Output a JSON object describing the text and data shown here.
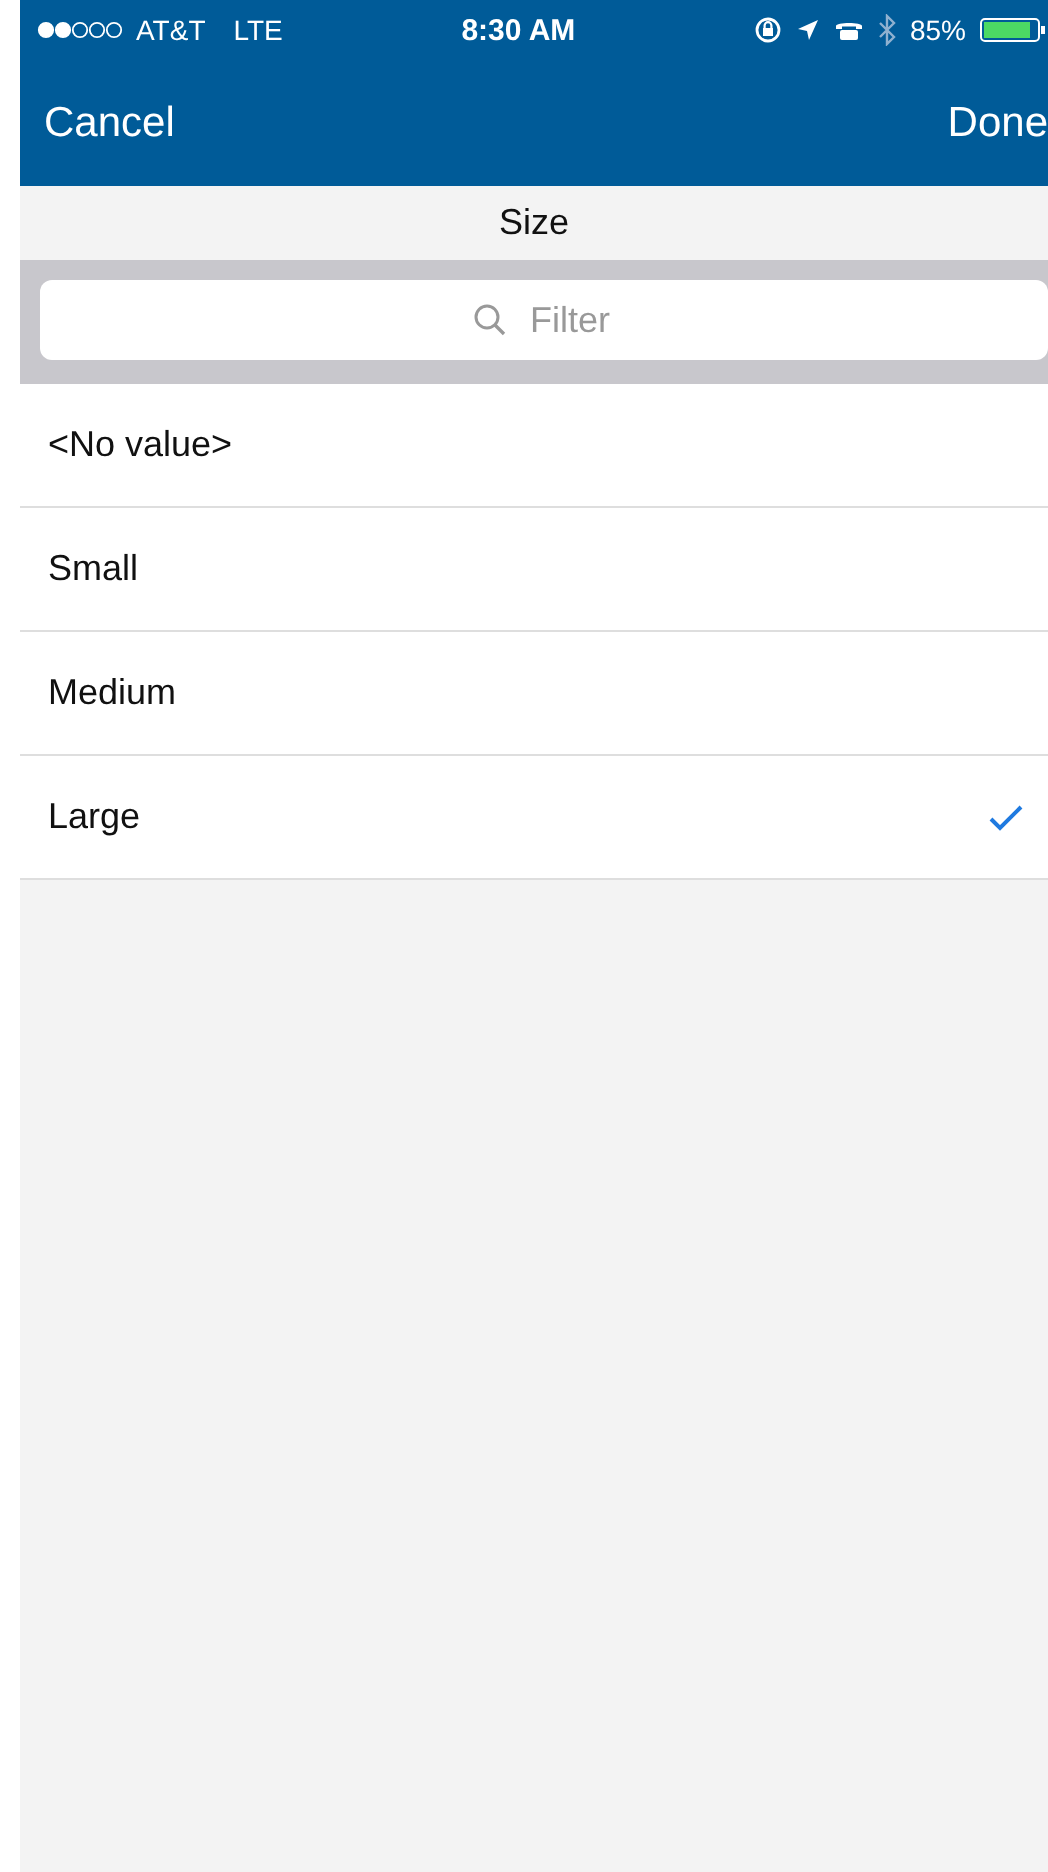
{
  "status_bar": {
    "carrier": "AT&T",
    "network": "LTE",
    "time": "8:30 AM",
    "battery": "85%"
  },
  "nav": {
    "cancel": "Cancel",
    "done": "Done"
  },
  "title": "Size",
  "search": {
    "placeholder": "Filter"
  },
  "options": [
    {
      "label": "<No value>",
      "selected": false
    },
    {
      "label": "Small",
      "selected": false
    },
    {
      "label": "Medium",
      "selected": false
    },
    {
      "label": "Large",
      "selected": true
    }
  ]
}
